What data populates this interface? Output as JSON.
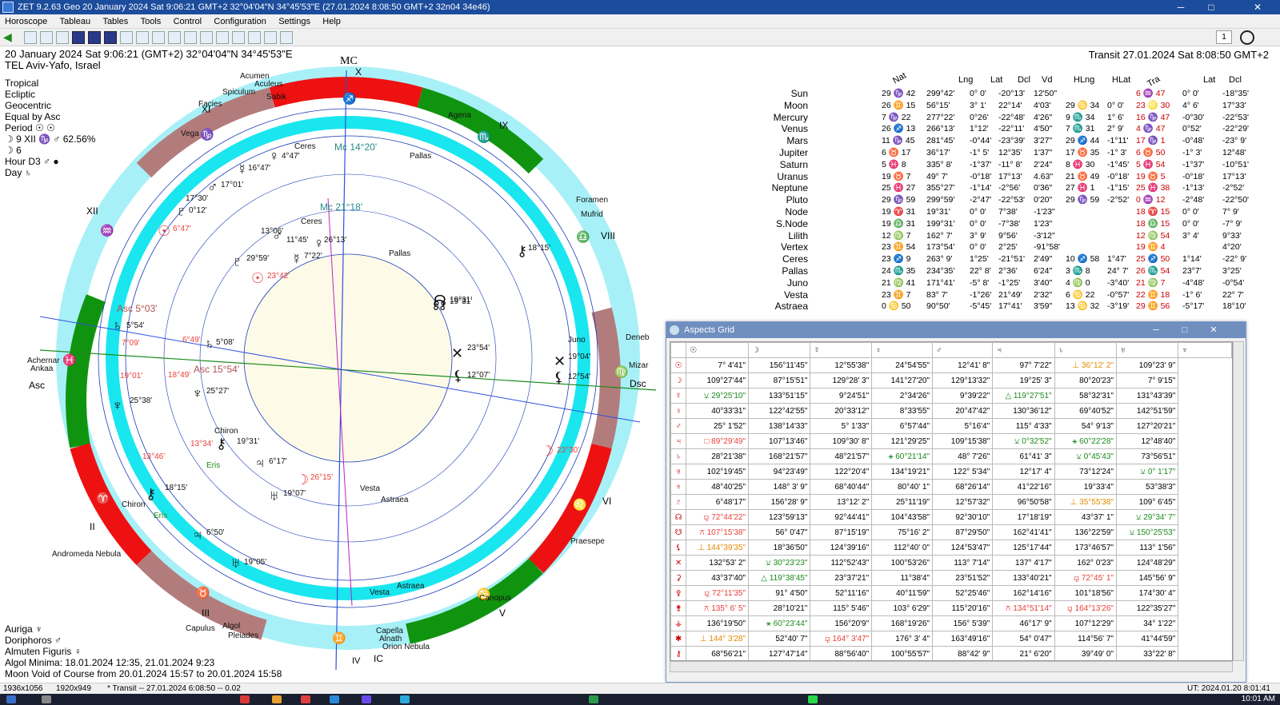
{
  "window": {
    "title": "ZET 9.2.63 Geo   20 January 2024  Sat   9:06:21 GMT+2 32°04'04\"N  34°45'53\"E  (27.01.2024   8:08:50 GMT+2 32n04 34e46)",
    "minimize": "─",
    "maximize": "□",
    "close": "✕"
  },
  "menu": [
    "Horoscope",
    "Tableau",
    "Tables",
    "Tools",
    "Control",
    "Configuration",
    "Settings",
    "Help"
  ],
  "toolbar": {
    "page_number": "1"
  },
  "header": {
    "date_line": "20 January 2024  Sat   9:06:21 (GMT+2) 32°04'04\"N  34°45'53\"E",
    "place": "TEL Aviv-Yafo, Israel",
    "transit": "Transit 27.01.2024  Sat  8:08:50 GMT+2"
  },
  "chart_info": [
    "Tropical",
    "Ecliptic",
    "Geocentric",
    "Equal by Asc",
    "Period ☉ ☉",
    "☽  9 XII ♑ ♂ 62.56%",
    "☽  6",
    "Hour D3 ♂ ●",
    "Day ♄"
  ],
  "bottom_info": [
    "Auriga  ♆",
    "Doriphoros  ♂",
    "Almuten Figuris  ♀",
    "Algol Minima: 18.01.2024 12:35,  21.01.2024  9:23",
    "Moon Void of Course from 20.01.2024 15:57 to 20.01.2024 15:58"
  ],
  "wheel": {
    "houses": [
      "X",
      "IX",
      "VIII",
      "VI",
      "V",
      "IV",
      "III",
      "II",
      "XII",
      "XI"
    ],
    "angles": {
      "mc": "MC",
      "ic": "IC",
      "asc": "Asc",
      "dsc": "Dsc"
    },
    "outer_labels": [
      "Acumen",
      "Aculeus",
      "Spiculum",
      "Sabik",
      "Facies",
      "Vega",
      "Agena",
      "Foramen",
      "Mufrid",
      "Deneb",
      "Mizar",
      "Praesepe",
      "Canopus",
      "Capella",
      "Alnath",
      "Orion Nebula",
      "Pleiades",
      "Algol",
      "Capulus",
      "Andromeda Nebula",
      "Achernar",
      "Ankaa"
    ],
    "transit_labels": [
      "Mc 14°20'",
      "Ceres",
      "Pallas",
      "4°47'",
      "16°47'",
      "17°01'",
      "0°12'",
      "6°47'",
      "17°30'",
      "18°15'",
      "19°31'",
      "23°54'",
      "Juno",
      "19°04'",
      "12°54'",
      "23°30'",
      "Asc 5°03'",
      "5°54'",
      "7°09'",
      "19°01'",
      "25°38'",
      "13°46'",
      "Chiron",
      "18°15'",
      "Eris",
      "6°50'",
      "19°05'",
      "Vesta",
      "Astraea"
    ],
    "natal_labels": [
      "Mc 21°18'",
      "13°06'",
      "11°45'",
      "26°13'",
      "7°22'",
      "Ceres",
      "29°59'",
      "23°42'",
      "Pallas",
      "19°31'",
      "12°07'",
      "Asc 15°54'",
      "6°49'",
      "5°08'",
      "18°49'",
      "25°27'",
      "13°34'",
      "Chiron",
      "19°31'",
      "Eris",
      "6°17'",
      "26°15'",
      "19°07'",
      "Vesta",
      "Astraea"
    ]
  },
  "planets": {
    "headers": {
      "nat": "Nat",
      "lng": "Lng",
      "lat": "Lat",
      "dcl": "Dcl",
      "vd": "Vd",
      "hlng": "HLng",
      "hlat": "HLat",
      "tra": "Tra",
      "lat2": "Lat",
      "dcl2": "Dcl"
    },
    "rows": [
      {
        "name": "Sun",
        "pos": "29 ♑ 42",
        "lng": "299°42'",
        "lat": "0° 0'",
        "dcl": "-20°13'",
        "vd": "12'50\"",
        "hl": "",
        "hlat": "",
        "tpos": "6 ♒ 47",
        "tlat": "0° 0'",
        "tdcl": "-18°35'"
      },
      {
        "name": "Moon",
        "pos": "26 ♊ 15",
        "lng": "56°15'",
        "lat": "3° 1'",
        "dcl": "22°14'",
        "vd": "4'03'",
        "hl": "29 ♋ 34",
        "hlat": "0° 0'",
        "tpos": "23 ♌ 30",
        "tlat": "4° 6'",
        "tdcl": "17°33'"
      },
      {
        "name": "Mercury",
        "pos": "7 ♑ 22",
        "lng": "277°22'",
        "lat": "0°26'",
        "dcl": "-22°48'",
        "vd": "4'26\"",
        "hl": "9 ♏ 34",
        "hlat": "1° 6'",
        "tpos": "16 ♑ 47",
        "tlat": "-0°30'",
        "tdcl": "-22°53'"
      },
      {
        "name": "Venus",
        "pos": "26 ♐ 13",
        "lng": "266°13'",
        "lat": "1°12'",
        "dcl": "-22°11'",
        "vd": "4'50\"",
        "hl": "7 ♏ 31",
        "hlat": "2° 9'",
        "tpos": "4 ♑ 47",
        "tlat": "0°52'",
        "tdcl": "-22°29'"
      },
      {
        "name": "Mars",
        "pos": "11 ♑ 45",
        "lng": "281°45'",
        "lat": "-0°44'",
        "dcl": "-23°39'",
        "vd": "3'27\"",
        "hl": "29 ♐ 44",
        "hlat": "-1°11'",
        "tpos": "17 ♑ 1",
        "tlat": "-0°48'",
        "tdcl": "-23° 9'"
      },
      {
        "name": "Jupiter",
        "pos": "6 ♉ 17",
        "lng": "36°17'",
        "lat": "-1° 5'",
        "dcl": "12°35'",
        "vd": "1'37\"",
        "hl": "17 ♉ 35",
        "hlat": "-1° 3'",
        "tpos": "6 ♉ 50",
        "tlat": "-1° 3'",
        "tdcl": "12°48'"
      },
      {
        "name": "Saturn",
        "pos": "5 ♓ 8",
        "lng": "335° 8'",
        "lat": "-1°37'",
        "dcl": "-11° 8'",
        "vd": "2'24\"",
        "hl": "8 ♓ 30",
        "hlat": "-1°45'",
        "tpos": "5 ♓ 54",
        "tlat": "-1°37'",
        "tdcl": "-10°51'"
      },
      {
        "name": "Uranus",
        "pos": "19 ♉ 7",
        "lng": "49° 7'",
        "lat": "-0°18'",
        "dcl": "17°13'",
        "vd": "4.63\"",
        "hl": "21 ♉ 49",
        "hlat": "-0°18'",
        "tpos": "19 ♉ 5",
        "tlat": "-0°18'",
        "tdcl": "17°13'"
      },
      {
        "name": "Neptune",
        "pos": "25 ♓ 27",
        "lng": "355°27'",
        "lat": "-1°14'",
        "dcl": "-2°56'",
        "vd": "0'36\"",
        "hl": "27 ♓ 1",
        "hlat": "-1°15'",
        "tpos": "25 ♓ 38",
        "tlat": "-1°13'",
        "tdcl": "-2°52'"
      },
      {
        "name": "Pluto",
        "pos": "29 ♑ 59",
        "lng": "299°59'",
        "lat": "-2°47'",
        "dcl": "-22°53'",
        "vd": "0'20\"",
        "hl": "29 ♑ 59",
        "hlat": "-2°52'",
        "tpos": "0 ♒ 12",
        "tlat": "-2°48'",
        "tdcl": "-22°50'"
      },
      {
        "name": "Node",
        "pos": "19 ♈ 31",
        "lng": "19°31'",
        "lat": "0° 0'",
        "dcl": "7°38'",
        "vd": "-1'23\"",
        "hl": "",
        "hlat": "",
        "tpos": "18 ♈ 15",
        "tlat": "0° 0'",
        "tdcl": "7° 9'"
      },
      {
        "name": "S.Node",
        "pos": "19 ♎ 31",
        "lng": "199°31'",
        "lat": "0° 0'",
        "dcl": "-7°38'",
        "vd": "1'23\"",
        "hl": "",
        "hlat": "",
        "tpos": "18 ♎ 15",
        "tlat": "0° 0'",
        "tdcl": "-7° 9'"
      },
      {
        "name": "Lilith",
        "pos": "12 ♍ 7",
        "lng": "162° 7'",
        "lat": "3° 9'",
        "dcl": "9°56'",
        "vd": "-3'12\"",
        "hl": "",
        "hlat": "",
        "tpos": "12 ♍ 54",
        "tlat": "3° 4'",
        "tdcl": "9°33'"
      },
      {
        "name": "Vertex",
        "pos": "23 ♊ 54",
        "lng": "173°54'",
        "lat": "0° 0'",
        "dcl": "2°25'",
        "vd": "-91°58'",
        "hl": "",
        "hlat": "",
        "tpos": "19 ♊ 4",
        "tlat": "",
        "tdcl": "4°20'"
      },
      {
        "name": "Ceres",
        "pos": "23 ♐ 9",
        "lng": "263° 9'",
        "lat": "1°25'",
        "dcl": "-21°51'",
        "vd": "2'49\"",
        "hl": "10 ♐ 58",
        "hlat": "1°47'",
        "tpos": "25 ♐ 50",
        "tlat": "1°14'",
        "tdcl": "-22° 9'"
      },
      {
        "name": "Pallas",
        "pos": "24 ♏ 35",
        "lng": "234°35'",
        "lat": "22° 8'",
        "dcl": "2°36'",
        "vd": "6'24\"",
        "hl": "3 ♏ 8",
        "hlat": "24° 7'",
        "tpos": "26 ♏ 54",
        "tlat": "23°7'",
        "tdcl": "3°25'"
      },
      {
        "name": "Juno",
        "pos": "21 ♍ 41",
        "lng": "171°41'",
        "lat": "-5° 8'",
        "dcl": "-1°25'",
        "vd": "3'40\"",
        "hl": "4 ♍ 0",
        "hlat": "-3°40'",
        "tpos": "21 ♍ 7",
        "tlat": "-4°48'",
        "tdcl": "-0°54'"
      },
      {
        "name": "Vesta",
        "pos": "23 ♊ 7",
        "lng": "83° 7'",
        "lat": "-1°26'",
        "dcl": "21°49'",
        "vd": "2'32\"",
        "hl": "6 ♋ 22",
        "hlat": "-0°57'",
        "tpos": "22 ♊ 18",
        "tlat": "-1° 6'",
        "tdcl": "22° 7'"
      },
      {
        "name": "Astraea",
        "pos": "0 ♋ 50",
        "lng": "90°50'",
        "lat": "-5°45'",
        "dcl": "17°41'",
        "vd": "3'59\"",
        "hl": "13 ♋ 32",
        "hlat": "-3°19'",
        "tpos": "29 ♊ 56",
        "tlat": "-5°17'",
        "tdcl": "18°10'"
      }
    ]
  },
  "aspects_window": {
    "title": "Aspects Grid",
    "col_heads": [
      "☉",
      "☽",
      "☿",
      "♀",
      "♂",
      "♃",
      "♄",
      "♅",
      "♆"
    ],
    "rows": [
      {
        "h": "☉",
        "c": [
          "7° 4'41\"",
          "156°11'45\"",
          "12°55'38\"",
          "24°54'55\"",
          "12°41' 8\"",
          "97° 7'22\"",
          "⊥ 36°12' 2\"",
          "109°23' 9\""
        ]
      },
      {
        "h": "☽",
        "c": [
          "109°27'44\"",
          "87°15'51\"",
          "129°28' 3\"",
          "141°27'20\"",
          "129°13'32\"",
          "19°25' 3\"",
          "80°20'23\"",
          "7° 9'15\""
        ]
      },
      {
        "h": "☿",
        "c": [
          "⚺ 29°25'10\"",
          "133°51'15\"",
          "9°24'51\"",
          "2°34'26\"",
          "9°39'22\"",
          "△ 119°27'51\"",
          "58°32'31\"",
          "131°43'39\""
        ]
      },
      {
        "h": "♀",
        "c": [
          "40°33'31\"",
          "122°42'55\"",
          "20°33'12\"",
          "8°33'55\"",
          "20°47'42\"",
          "130°36'12\"",
          "69°40'52\"",
          "142°51'59\""
        ]
      },
      {
        "h": "♂",
        "c": [
          "25° 1'52\"",
          "138°14'33\"",
          "5° 1'33\"",
          "6°57'44\"",
          "5°16'4\"",
          "115° 4'33\"",
          "54° 9'13\"",
          "127°20'21\""
        ]
      },
      {
        "h": "♃",
        "c": [
          "□ 89°29'49\"",
          "107°13'46\"",
          "109°30' 8\"",
          "121°29'25\"",
          "109°15'38\"",
          "⚺ 0°32'52\"",
          "⚹ 60°22'28\"",
          "12°48'40\""
        ]
      },
      {
        "h": "♄",
        "c": [
          "28°21'38\"",
          "168°21'57\"",
          "48°21'57\"",
          "⚹ 60°21'14\"",
          "48° 7'26\"",
          "61°41' 3\"",
          "⚺ 0°45'43\"",
          "73°56'51\""
        ]
      },
      {
        "h": "♅",
        "c": [
          "102°19'45\"",
          "94°23'49\"",
          "122°20'4\"",
          "134°19'21\"",
          "122° 5'34\"",
          "12°17' 4\"",
          "73°12'24\"",
          "⚺ 0° 1'17\""
        ]
      },
      {
        "h": "♆",
        "c": [
          "48°40'25\"",
          "148° 3' 9\"",
          "68°40'44\"",
          "80°40' 1\"",
          "68°26'14\"",
          "41°22'16\"",
          "19°33'4\"",
          "53°38'3\""
        ]
      },
      {
        "h": "♇",
        "c": [
          "6°48'17\"",
          "156°28' 9\"",
          "13°12' 2\"",
          "25°11'19\"",
          "12°57'32\"",
          "96°50'58\"",
          "⊥ 35°55'38\"",
          "109° 6'45\""
        ]
      },
      {
        "h": "☊",
        "c": [
          "⚼ 72°44'22\"",
          "123°59'13\"",
          "92°44'41\"",
          "104°43'58\"",
          "92°30'10\"",
          "17°18'19\"",
          "43°37' 1\"",
          "⚺ 29°34' 7\""
        ]
      },
      {
        "h": "☋",
        "c": [
          "⚻ 107°15'38\"",
          "56° 0'47\"",
          "87°15'19\"",
          "75°16' 2\"",
          "87°29'50\"",
          "162°41'41\"",
          "136°22'59\"",
          "⚺ 150°25'53\""
        ]
      },
      {
        "h": "⚸",
        "c": [
          "⊥ 144°39'35\"",
          "18°36'50\"",
          "124°39'16\"",
          "112°40' 0\"",
          "124°53'47\"",
          "125°17'44\"",
          "173°46'57\"",
          "113° 1'56\""
        ]
      },
      {
        "h": "✕",
        "c": [
          "132°53' 2\"",
          "⚺ 30°23'23\"",
          "112°52'43\"",
          "100°53'26\"",
          "113° 7'14\"",
          "137° 4'17\"",
          "162° 0'23\"",
          "124°48'29\""
        ]
      },
      {
        "h": "⚳",
        "c": [
          "43°37'40\"",
          "△ 119°38'45\"",
          "23°37'21\"",
          "11°38'4\"",
          "23°51'52\"",
          "133°40'21\"",
          "⚼ 72°45' 1\"",
          "145°56' 9\""
        ]
      },
      {
        "h": "⚴",
        "c": [
          "⚼ 72°11'35\"",
          "91° 4'50\"",
          "52°11'16\"",
          "40°11'59\"",
          "52°25'46\"",
          "162°14'16\"",
          "101°18'56\"",
          "174°30' 4\""
        ]
      },
      {
        "h": "⚵",
        "c": [
          "⚻ 135° 6' 5\"",
          "28°10'21\"",
          "115° 5'46\"",
          "103° 6'29\"",
          "115°20'16\"",
          "⚻ 134°51'14\"",
          "⚼ 164°13'26\"",
          "122°35'27\""
        ]
      },
      {
        "h": "⚶",
        "c": [
          "136°19'50\"",
          "⚹ 60°23'44\"",
          "156°20'9\"",
          "168°19'26\"",
          "156° 5'39\"",
          "46°17' 9\"",
          "107°12'29\"",
          "34° 1'22\""
        ]
      },
      {
        "h": "✱",
        "c": [
          "⊥ 144° 3'28\"",
          "52°40' 7\"",
          "⚼ 164° 3'47\"",
          "176° 3' 4\"",
          "163°49'16\"",
          "54° 0'47\"",
          "114°56' 7\"",
          "41°44'59\""
        ]
      },
      {
        "h": "⚷",
        "c": [
          "68°56'21\"",
          "127°47'14\"",
          "88°56'40\"",
          "100°55'57\"",
          "88°42' 9\"",
          "21° 6'20\"",
          "39°49' 0\"",
          "33°22' 8\""
        ]
      }
    ]
  },
  "status": {
    "res1": "1936x1056",
    "res2": "1920x949",
    "transit": "* Transit -- 27.01.2024  6:08:50 -- 0.02",
    "right": "UT: 2024.01.20  8:01:41"
  },
  "taskbar": {
    "time": "10:01 AM"
  },
  "colors": {
    "title_bg": "#1c4c9c",
    "cyan_ring": "#19e6ee",
    "red_segment": "#ee1111",
    "green_segment": "#109410",
    "rose_segment": "#b37c7c",
    "light_cyan_segment": "#a8f0f8"
  }
}
